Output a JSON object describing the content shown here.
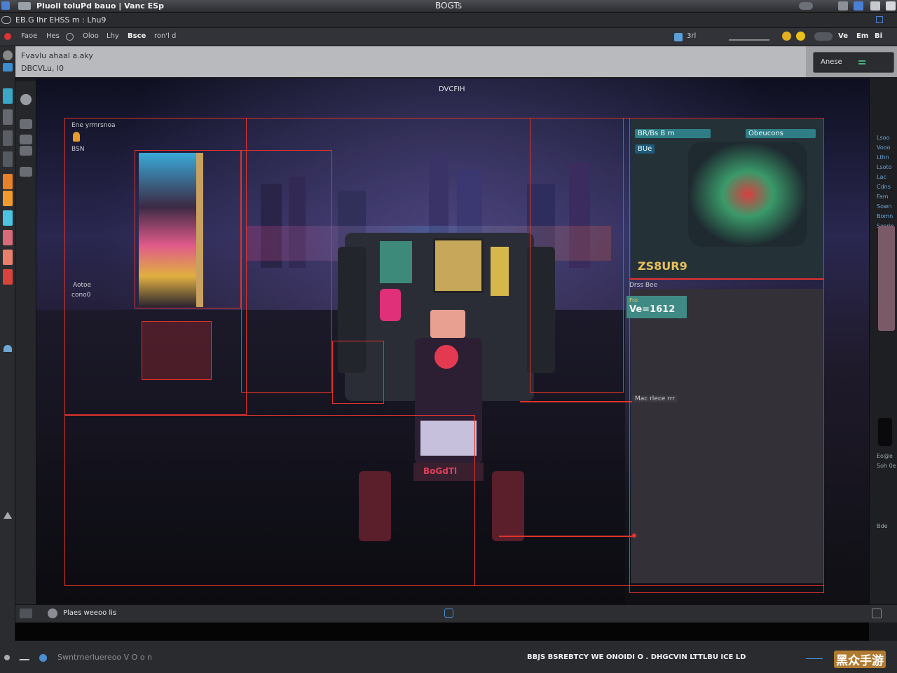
{
  "titlebar": {
    "app_title": "Pluoll toluPd bauo | Vanc ESp",
    "window_title": "BOGTs"
  },
  "menubar": {
    "path": "EB.G Ihr EHSS m : Lhu9"
  },
  "toolbar": {
    "items": [
      "Faoe",
      "Hes",
      "Oloo",
      "Lhy",
      "Bsce",
      "ron'l d"
    ],
    "right_items": [
      "3rl",
      "Ve",
      "Em",
      "Bi"
    ]
  },
  "infobar": {
    "line1": "Fvavlu ahaal a.aky",
    "line2": "DBCVLu, l0",
    "button": "Anese"
  },
  "canvas": {
    "top_label": "DVCFIH",
    "layer1": {
      "title": "Ene yrmrsnoa",
      "sub": "BSN"
    },
    "left_note": {
      "line1": "Aotoe",
      "line2": "cono0"
    },
    "panel_right": {
      "tag_left": "BR/Bs  B rn",
      "tag_left2": "BUe",
      "tag_right": "Obeucons",
      "bottom_text": "ZS8UR9",
      "label": "Drss Bee"
    },
    "value_tag": {
      "small": "Fro",
      "value": "Ve=1612"
    },
    "mid_note": "Mac rlece  rrr",
    "bottom_banner": "BoGdTl"
  },
  "bottom": {
    "label": "Plaes weeoo lis"
  },
  "statusbar": {
    "left_text": "Swntrnerluereoo V O o n",
    "center_text": "BBJS BSREBTCY WE ONOIDI O . DHGCVIN LTTLBU ICE LD",
    "watermark": "黑众手游"
  },
  "right_strip": {
    "labels": [
      "Lsoo",
      "Vooo",
      "Lthn",
      "Lsoto",
      "Lac",
      "Cdns",
      "Fam",
      "Sown",
      "Bomn",
      "Sasrin"
    ],
    "bottom_labels": [
      "Eo@e",
      "Soh 0e",
      "Bde"
    ]
  },
  "colors": {
    "accent_red": "#e0332b",
    "teal": "#2f7e86",
    "bg_dark": "#1a1b1f"
  }
}
